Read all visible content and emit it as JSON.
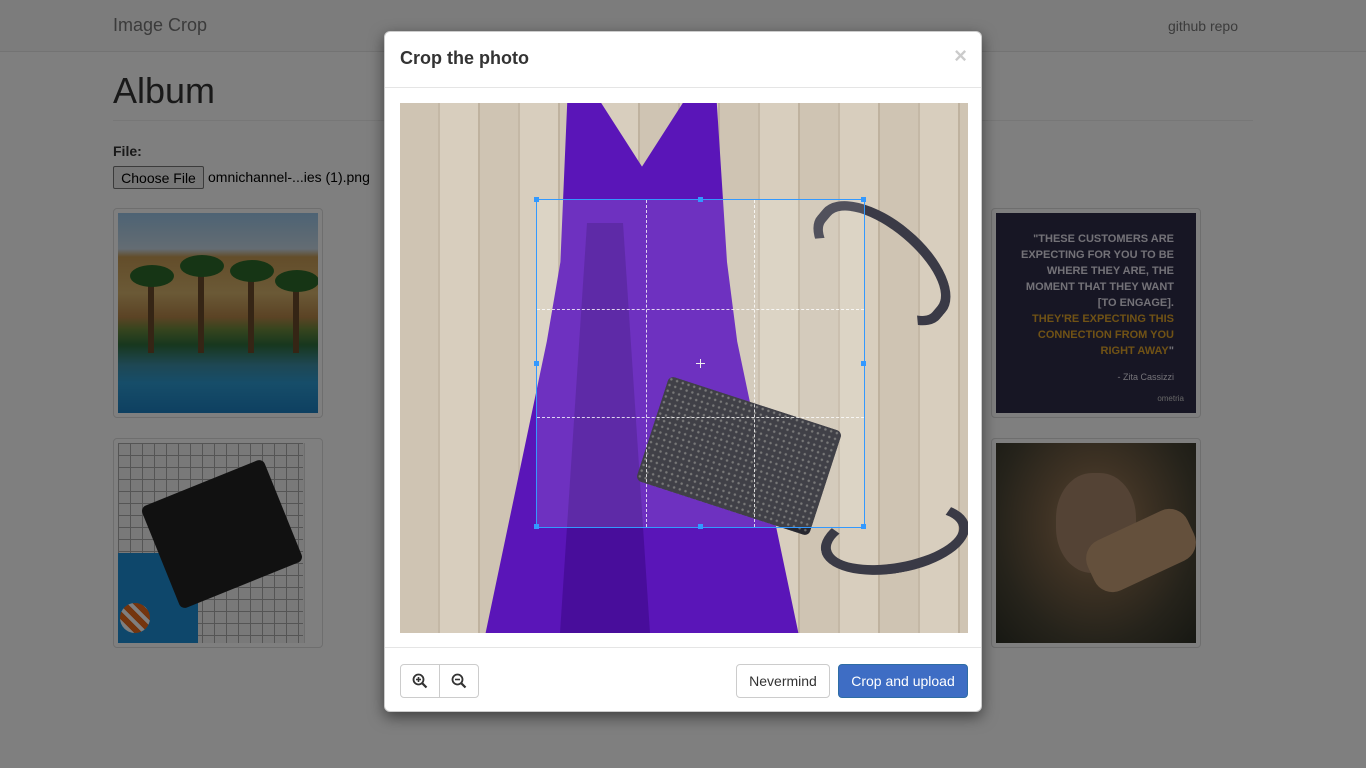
{
  "navbar": {
    "brand": "Image Crop",
    "link": "github repo"
  },
  "page": {
    "title": "Album"
  },
  "file": {
    "label": "File:",
    "button": "Choose File",
    "filename": "omnichannel-...ies (1).png"
  },
  "album": {
    "quote": {
      "line1": "\"THESE CUSTOMERS ARE EXPECTING FOR YOU TO BE WHERE THEY ARE, THE MOMENT THAT THEY WANT [TO ENGAGE].",
      "line2": "THEY'RE EXPECTING THIS CONNECTION FROM YOU RIGHT AWAY",
      "closing": "\"",
      "author": "- Zita Cassizzi",
      "logo": "ometria"
    }
  },
  "modal": {
    "title": "Crop the photo",
    "close": "×",
    "zoom_in_icon": "zoom-in-icon",
    "zoom_out_icon": "zoom-out-icon",
    "cancel": "Nevermind",
    "submit": "Crop and upload"
  },
  "colors": {
    "primary": "#3e6dc4",
    "crop_outline": "#3399ff"
  }
}
